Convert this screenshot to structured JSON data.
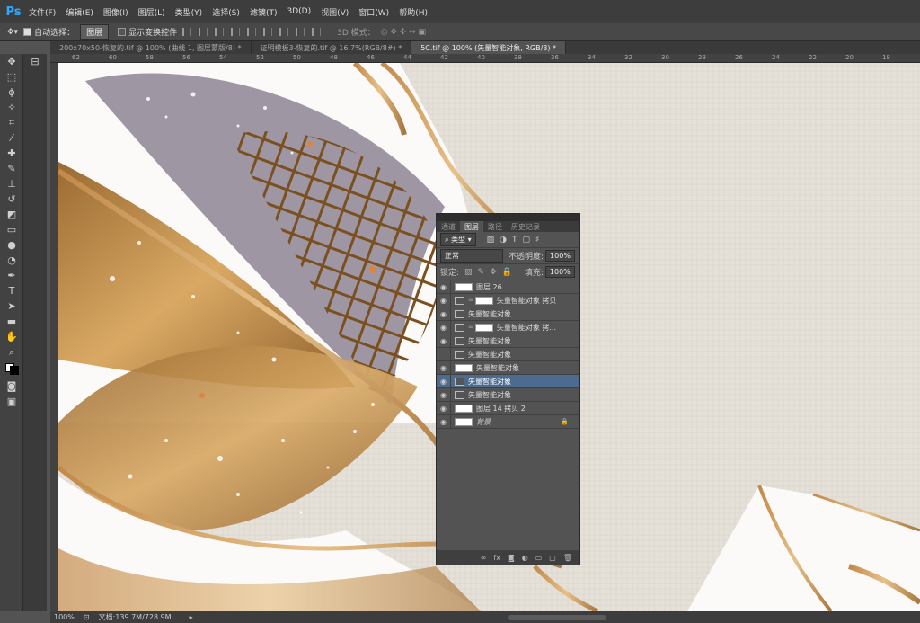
{
  "app": {
    "logo": "Ps"
  },
  "menu": [
    "文件(F)",
    "编辑(E)",
    "图像(I)",
    "图层(L)",
    "类型(Y)",
    "选择(S)",
    "滤镜(T)",
    "3D(D)",
    "视图(V)",
    "窗口(W)",
    "帮助(H)"
  ],
  "options": {
    "auto_select_label": "自动选择：",
    "auto_select_value": "图层",
    "show_transform_label": "显示变换控件",
    "mode_3d_label": "3D 模式："
  },
  "doc_tabs": [
    "200x70x50-恢复的.tif @ 100% (曲线 1, 图层蒙版/8) *",
    "证明模板3-恢复的.tif @ 16.7%(RGB/8#) *",
    "5C.tif @ 100% (矢量智能对象, RGB/8) *"
  ],
  "ruler_top": [
    "62",
    "60",
    "58",
    "56",
    "54",
    "52",
    "50",
    "48",
    "46",
    "44",
    "42",
    "40",
    "38",
    "36",
    "34",
    "32",
    "30",
    "28",
    "26",
    "24",
    "22",
    "20",
    "18"
  ],
  "status": {
    "zoom": "100%",
    "doc": "文档:139.7M/728.9M"
  },
  "layers_panel": {
    "tabs": [
      "通道",
      "图层",
      "路径",
      "历史记录"
    ],
    "filter": "类型",
    "blend": "正常",
    "opacity_label": "不透明度:",
    "opacity": "100%",
    "lock_label": "锁定:",
    "fill_label": "填充:",
    "fill": "100%",
    "layers": [
      {
        "name": "图层 26",
        "kind": "pixel",
        "visible": true
      },
      {
        "name": "矢量智能对象 拷贝",
        "kind": "mask",
        "visible": true
      },
      {
        "name": "矢量智能对象",
        "kind": "so",
        "visible": true
      },
      {
        "name": "矢量智能对象 拷...",
        "kind": "mask",
        "visible": true
      },
      {
        "name": "矢量智能对象",
        "kind": "so",
        "visible": true
      },
      {
        "name": "矢量智能对象",
        "kind": "so",
        "visible": false
      },
      {
        "name": "矢量智能对象",
        "kind": "pixel",
        "visible": true
      },
      {
        "name": "矢量智能对象",
        "kind": "so",
        "visible": true,
        "selected": true
      },
      {
        "name": "矢量智能对象",
        "kind": "so",
        "visible": true
      },
      {
        "name": "图层 14 拷贝 2",
        "kind": "pixel",
        "visible": true
      },
      {
        "name": "背景",
        "kind": "pixel",
        "visible": true,
        "locked": true
      }
    ],
    "footer_icons": [
      "link-icon",
      "fx-icon",
      "mask-icon",
      "adjust-icon",
      "folder-icon",
      "new-layer-icon",
      "trash-icon"
    ],
    "footer_glyphs": [
      "∞",
      "fx",
      "◙",
      "◐",
      "▭",
      "▢",
      "🗑"
    ]
  },
  "colors": {
    "accent": "#4d6b8f",
    "gold": "#c8955a"
  }
}
